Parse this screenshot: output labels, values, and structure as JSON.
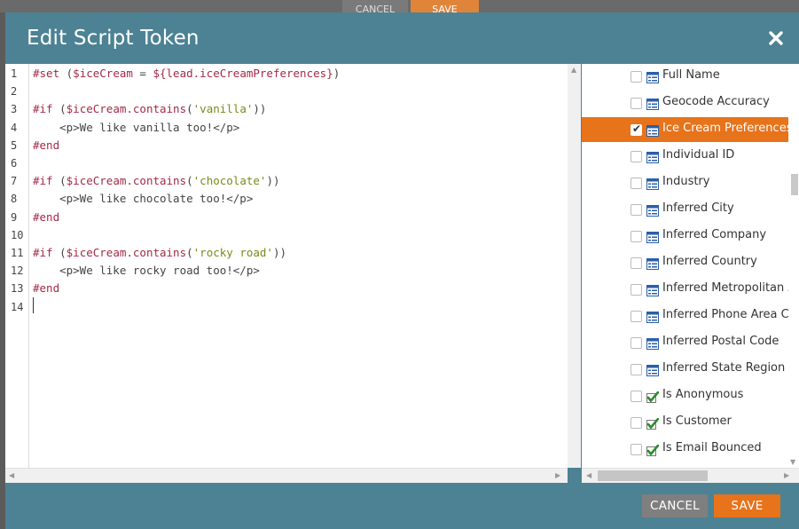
{
  "background": {
    "cancel_label": "CANCEL",
    "save_label": "SAVE"
  },
  "dialog": {
    "title": "Edit Script Token"
  },
  "editor": {
    "line_numbers": [
      "1",
      "2",
      "3",
      "4",
      "5",
      "6",
      "7",
      "8",
      "9",
      "10",
      "11",
      "12",
      "13",
      "14"
    ],
    "lines": [
      [
        {
          "t": "#set ",
          "c": "kw"
        },
        {
          "t": "(",
          "c": ""
        },
        {
          "t": "$iceCream",
          "c": "kw"
        },
        {
          "t": " = ",
          "c": ""
        },
        {
          "t": "${lead.iceCreamPreferences}",
          "c": "kw"
        },
        {
          "t": ")",
          "c": ""
        }
      ],
      [],
      [
        {
          "t": "#if ",
          "c": "kw"
        },
        {
          "t": "(",
          "c": ""
        },
        {
          "t": "$iceCream.contains",
          "c": "kw"
        },
        {
          "t": "(",
          "c": ""
        },
        {
          "t": "'vanilla'",
          "c": "str"
        },
        {
          "t": "))",
          "c": ""
        }
      ],
      [
        {
          "t": "    <p>We like vanilla too!</p>",
          "c": ""
        }
      ],
      [
        {
          "t": "#end",
          "c": "kw"
        }
      ],
      [],
      [
        {
          "t": "#if ",
          "c": "kw"
        },
        {
          "t": "(",
          "c": ""
        },
        {
          "t": "$iceCream.contains",
          "c": "kw"
        },
        {
          "t": "(",
          "c": ""
        },
        {
          "t": "'chocolate'",
          "c": "str"
        },
        {
          "t": "))",
          "c": ""
        }
      ],
      [
        {
          "t": "    <p>We like chocolate too!</p>",
          "c": ""
        }
      ],
      [
        {
          "t": "#end",
          "c": "kw"
        }
      ],
      [],
      [
        {
          "t": "#if ",
          "c": "kw"
        },
        {
          "t": "(",
          "c": ""
        },
        {
          "t": "$iceCream.contains",
          "c": "kw"
        },
        {
          "t": "(",
          "c": ""
        },
        {
          "t": "'rocky road'",
          "c": "str"
        },
        {
          "t": "))",
          "c": ""
        }
      ],
      [
        {
          "t": "    <p>We like rocky road too!</p>",
          "c": ""
        }
      ],
      [
        {
          "t": "#end",
          "c": "kw"
        }
      ],
      []
    ]
  },
  "fields": [
    {
      "label": "Full Name",
      "icon": "field-icon",
      "checked": false,
      "selected": false
    },
    {
      "label": "Geocode Accuracy",
      "icon": "field-icon",
      "checked": false,
      "selected": false
    },
    {
      "label": "Ice Cream Preferences",
      "icon": "field-icon",
      "checked": true,
      "selected": true
    },
    {
      "label": "Individual ID",
      "icon": "field-icon",
      "checked": false,
      "selected": false
    },
    {
      "label": "Industry",
      "icon": "field-icon",
      "checked": false,
      "selected": false
    },
    {
      "label": "Inferred City",
      "icon": "field-icon",
      "checked": false,
      "selected": false
    },
    {
      "label": "Inferred Company",
      "icon": "field-icon",
      "checked": false,
      "selected": false
    },
    {
      "label": "Inferred Country",
      "icon": "field-icon",
      "checked": false,
      "selected": false
    },
    {
      "label": "Inferred Metropolitan A",
      "icon": "field-icon",
      "checked": false,
      "selected": false
    },
    {
      "label": "Inferred Phone Area Co",
      "icon": "field-icon",
      "checked": false,
      "selected": false
    },
    {
      "label": "Inferred Postal Code",
      "icon": "field-icon",
      "checked": false,
      "selected": false
    },
    {
      "label": "Inferred State Region",
      "icon": "field-icon",
      "checked": false,
      "selected": false
    },
    {
      "label": "Is Anonymous",
      "icon": "boolean-icon",
      "checked": false,
      "selected": false
    },
    {
      "label": "Is Customer",
      "icon": "boolean-icon",
      "checked": false,
      "selected": false
    },
    {
      "label": "Is Email Bounced",
      "icon": "boolean-icon",
      "checked": false,
      "selected": false
    }
  ],
  "footer": {
    "cancel_label": "CANCEL",
    "save_label": "SAVE"
  },
  "colors": {
    "header": "#4c8294",
    "accent": "#e7731b",
    "cancel": "#7f7f7f",
    "keyword": "#a32a47",
    "string": "#7a8a18"
  }
}
